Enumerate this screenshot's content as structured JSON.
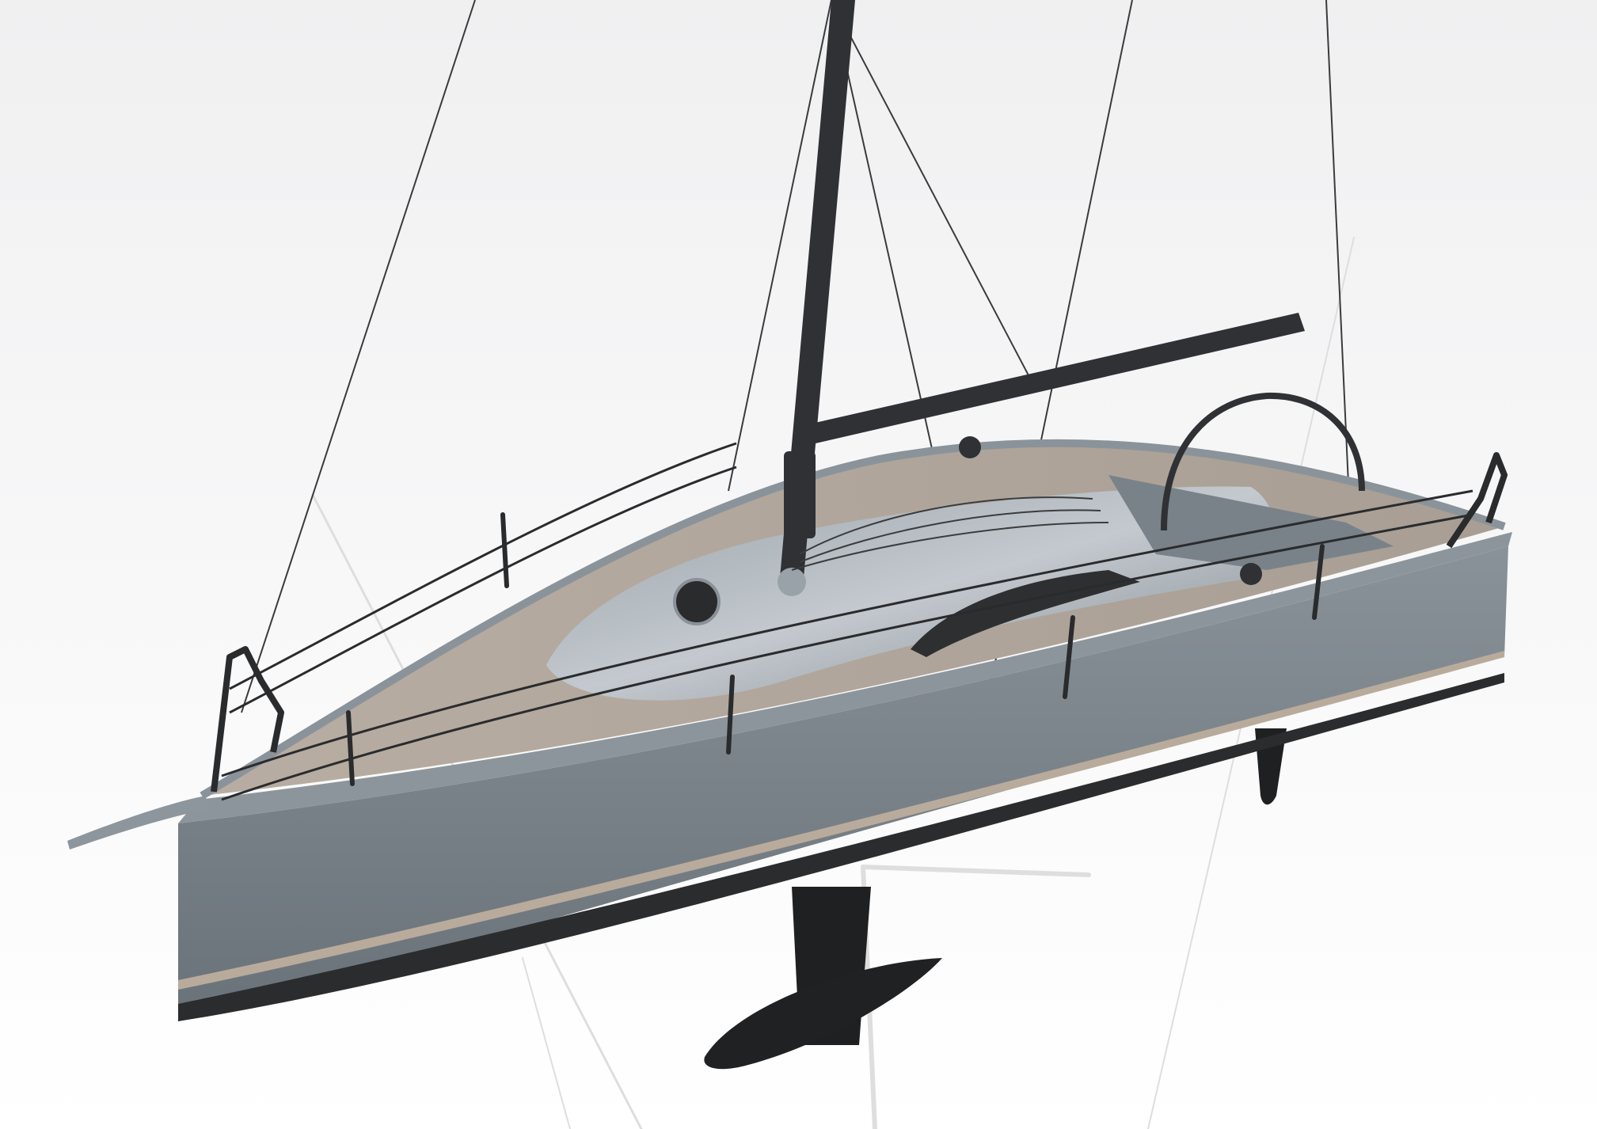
{
  "image": {
    "subject": "sailboat-3d-render"
  },
  "colors": {
    "background": "#f4f4f5",
    "hull": "#7d858c",
    "hull_dark": "#5d646b",
    "hull_light": "#a3abb2",
    "deck_teak": "#b3a99e",
    "cabin_top": "#8f979e",
    "stripe": "#b9ab9c",
    "waterline": "#2b2c2e",
    "spar_black": "#2f3134",
    "foil_black": "#1f2022",
    "rigging": "#3a3b3d",
    "reflection": "#dcdcdc"
  }
}
